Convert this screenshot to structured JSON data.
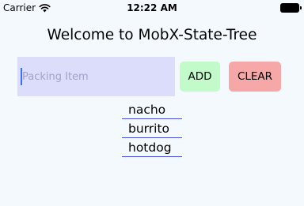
{
  "status_bar": {
    "carrier": "Carrier",
    "time": "12:22 AM",
    "icons": [
      "wifi-icon",
      "battery-icon"
    ]
  },
  "title": "Welcome to MobX-State-Tree",
  "input": {
    "placeholder": "Packing Item",
    "value": ""
  },
  "buttons": {
    "add": "ADD",
    "clear": "CLEAR"
  },
  "items": [
    "nacho",
    "burrito",
    "hotdog"
  ],
  "colors": {
    "background": "#f4f9fd",
    "input_bg": "#dcdcfb",
    "add_bg": "#c2fac9",
    "clear_bg": "#f6a8a8",
    "underline": "#4b4fd8",
    "caret": "#3b6ff6"
  }
}
